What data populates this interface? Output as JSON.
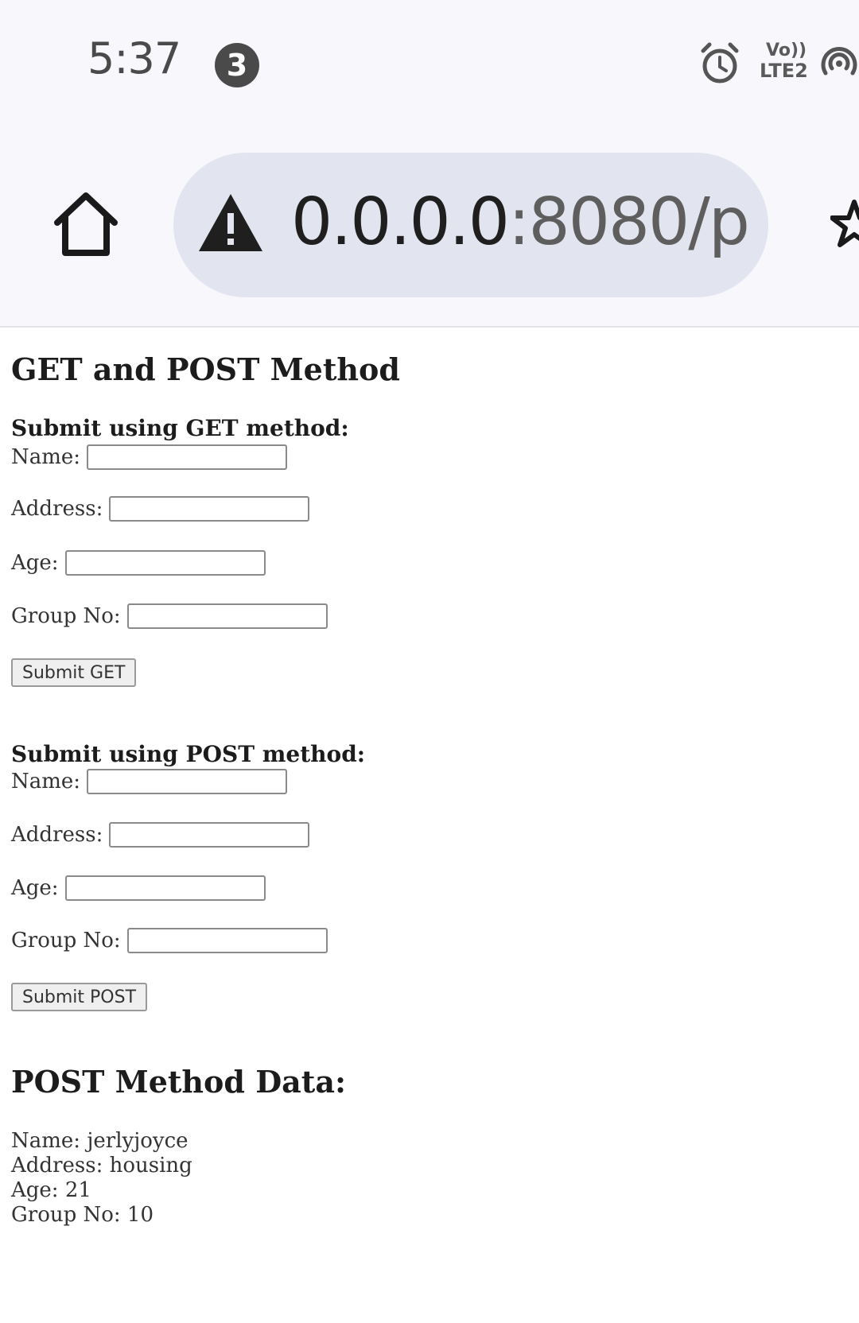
{
  "status_bar": {
    "time": "5:37",
    "notification_count": "3",
    "volte_top": "Vo))",
    "volte_bottom": "LTE2",
    "icons": [
      "alarm-icon",
      "volte-icon",
      "hotspot-icon"
    ]
  },
  "browser": {
    "url_host": "0.0.0.0",
    "url_rest": ":8080/p",
    "icons": [
      "home-icon",
      "warning-icon",
      "star-icon"
    ]
  },
  "page": {
    "title": "GET and POST Method",
    "get_form": {
      "heading": "Submit using GET method:",
      "name_label": "Name:",
      "address_label": "Address:",
      "age_label": "Age:",
      "group_label": "Group No:",
      "name_value": "",
      "address_value": "",
      "age_value": "",
      "group_value": "",
      "submit_label": "Submit GET"
    },
    "post_form": {
      "heading": "Submit using POST method:",
      "name_label": "Name:",
      "address_label": "Address:",
      "age_label": "Age:",
      "group_label": "Group No:",
      "name_value": "",
      "address_value": "",
      "age_value": "",
      "group_value": "",
      "submit_label": "Submit POST"
    },
    "post_data": {
      "heading": "POST Method Data:",
      "name": "Name: jerlyjoyce",
      "address": "Address: housing",
      "age": "Age: 21",
      "group": "Group No: 10"
    }
  }
}
